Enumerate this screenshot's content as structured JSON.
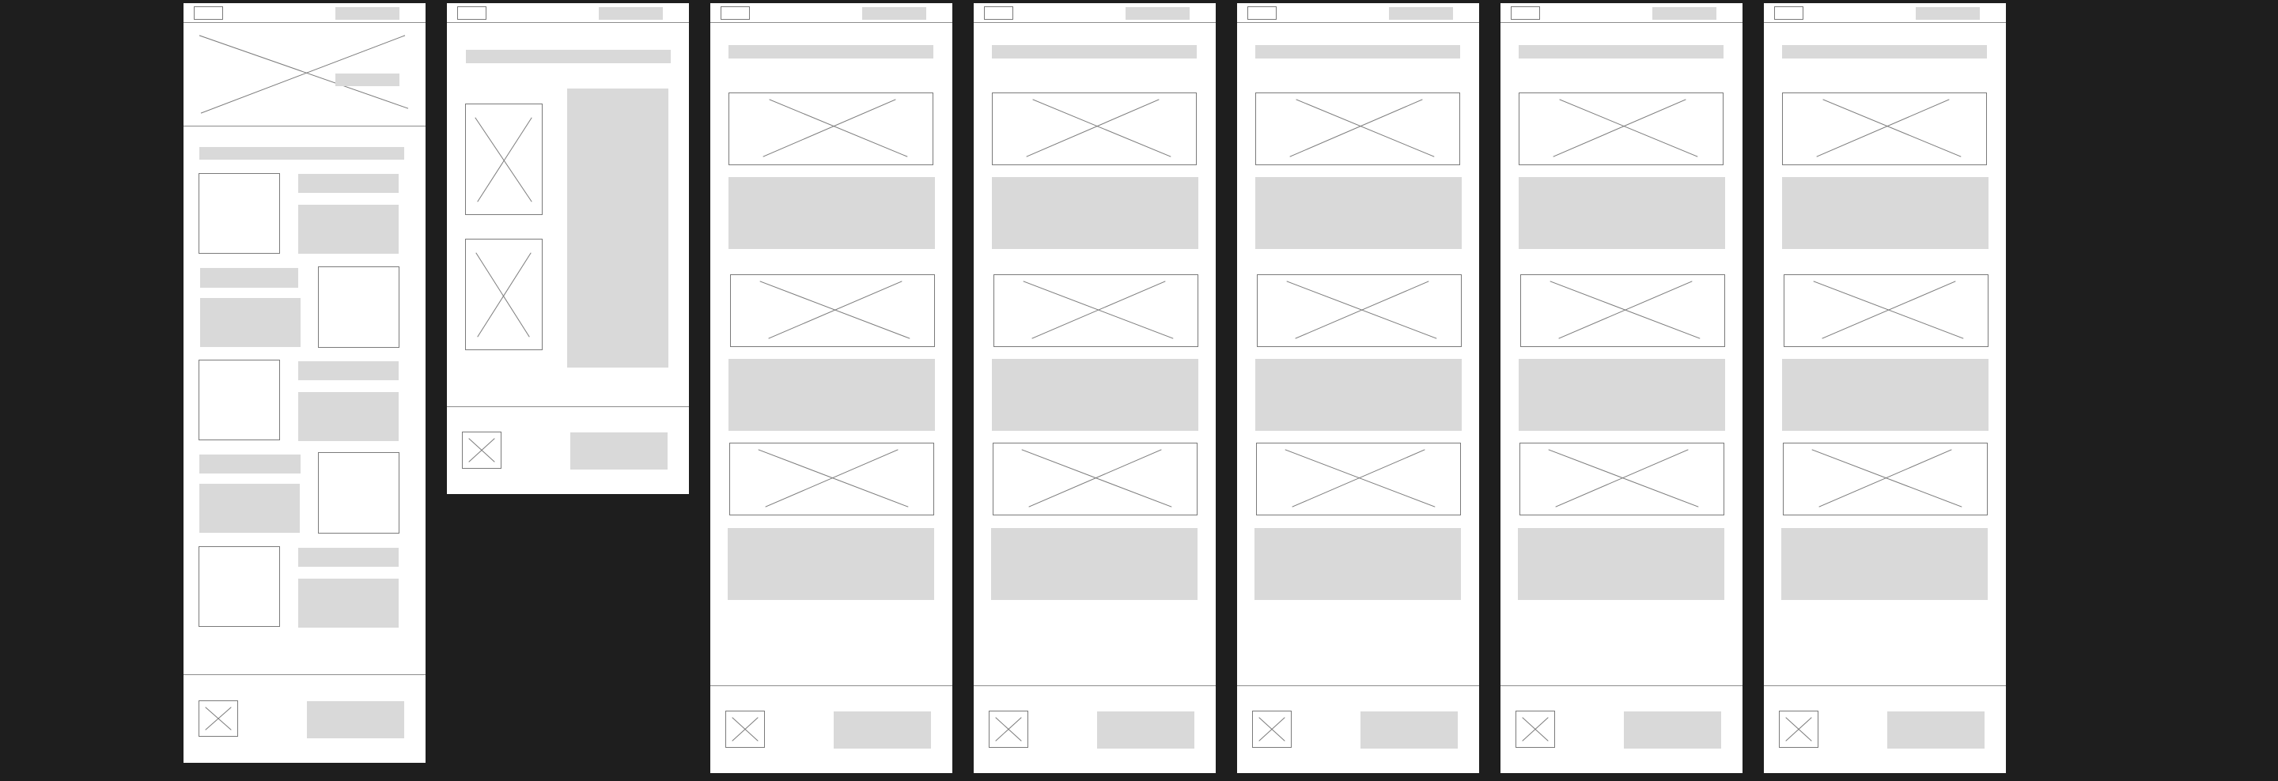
{
  "canvas": {
    "background": "#1e1e1e"
  },
  "colors": {
    "frame": "#ffffff",
    "placeholder_fill": "#d9d9d9",
    "stroke": "#7a7a7a"
  },
  "screens": [
    {
      "id": "screen-1",
      "layout": "alternating-list"
    },
    {
      "id": "screen-2",
      "layout": "image-column-with-text"
    },
    {
      "id": "screen-3",
      "layout": "stacked-cards"
    },
    {
      "id": "screen-4",
      "layout": "stacked-cards"
    },
    {
      "id": "screen-5",
      "layout": "stacked-cards"
    },
    {
      "id": "screen-6",
      "layout": "stacked-cards"
    },
    {
      "id": "screen-7",
      "layout": "stacked-cards"
    }
  ]
}
